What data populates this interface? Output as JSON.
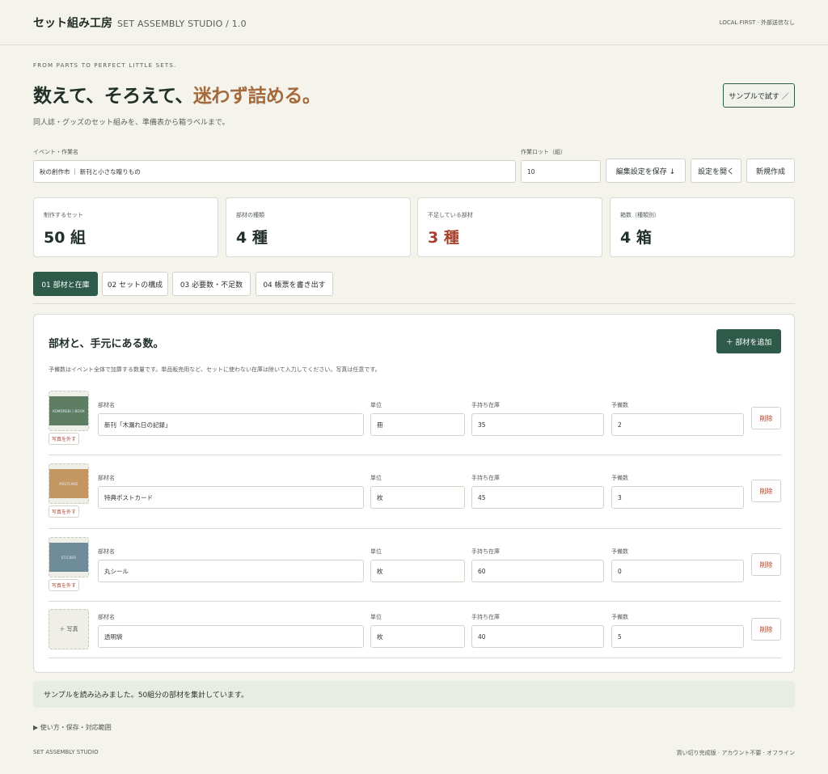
{
  "header": {
    "brand_name": "セット組み工房",
    "brand_sub": "SET ASSEMBLY STUDIO / 1.0",
    "note": "LOCAL FIRST · 外部送信なし"
  },
  "hero": {
    "eyebrow": "FROM PARTS TO PERFECT LITTLE SETS.",
    "title_main": "数えて、そろえて、",
    "title_accent": "迷わず詰める。",
    "lede": "同人誌・グッズのセット組みを、準備表から箱ラベルまで。",
    "sample_button": "サンプルで試す ／"
  },
  "event": {
    "name_label": "イベント・作業名",
    "name_value": "秋の創作市 ｜ 新刊と小さな贈りもの",
    "lot_label": "作業ロット（組）",
    "lot_value": "10",
    "save_button": "編集設定を保存 ↓",
    "open_button": "設定を開く",
    "new_button": "新規作成"
  },
  "stats": [
    {
      "label": "制作するセット",
      "value": "50 組",
      "warn": false
    },
    {
      "label": "部材の種類",
      "value": "4 種",
      "warn": false
    },
    {
      "label": "不足している部材",
      "value": "3 種",
      "warn": true
    },
    {
      "label": "箱数（種類別）",
      "value": "4 箱",
      "warn": false
    }
  ],
  "tabs": [
    {
      "label": "01 部材と在庫",
      "active": true
    },
    {
      "label": "02 セットの構成",
      "active": false
    },
    {
      "label": "03 必要数・不足数",
      "active": false
    },
    {
      "label": "04 帳票を書き出す",
      "active": false
    }
  ],
  "panel": {
    "title": "部材と、手元にある数。",
    "add_button": "＋ 部材を追加",
    "note": "予備数はイベント全体で加算する数量です。単品販売用など、セットに使わない在庫は除いて入力してください。写真は任意です。",
    "col_name": "部材名",
    "col_unit": "単位",
    "col_stock": "手持ち在庫",
    "col_spare": "予備数",
    "delete_label": "削除",
    "remove_photo_label": "写真を外す",
    "add_photo_label": "＋ 写真",
    "parts": [
      {
        "name": "新刊「木漏れ日の記録」",
        "unit": "冊",
        "stock": "35",
        "spare": "2",
        "photo_caption": "KOMOREBI / BOOK",
        "photo_color": "#5d7e63",
        "has_photo": true
      },
      {
        "name": "特典ポストカード",
        "unit": "枚",
        "stock": "45",
        "spare": "3",
        "photo_caption": "POSTCARD",
        "photo_color": "#c49662",
        "has_photo": true
      },
      {
        "name": "丸シール",
        "unit": "枚",
        "stock": "60",
        "spare": "0",
        "photo_caption": "STICKER",
        "photo_color": "#6f8c9a",
        "has_photo": true
      },
      {
        "name": "透明袋",
        "unit": "枚",
        "stock": "40",
        "spare": "5",
        "photo_caption": "",
        "photo_color": "",
        "has_photo": false
      }
    ]
  },
  "status": "サンプルを読み込みました。50組分の部材を集計しています。",
  "details_toggle": "▶ 使い方・保存・対応範囲",
  "footer": {
    "left": "SET ASSEMBLY STUDIO",
    "right": "買い切り完成版 · アカウント不要 · オフライン"
  }
}
